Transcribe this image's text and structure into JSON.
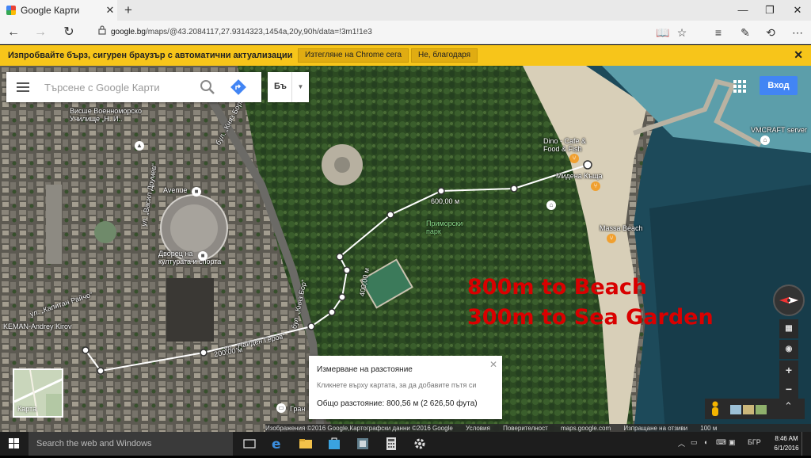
{
  "browser": {
    "tab_title": "Google Карти",
    "url_host": "google.bg",
    "url_path": "/maps/@43.2084117,27.9314323,1454a,20y,90h/data=!3m1!1e3"
  },
  "infobar": {
    "message": "Изпробвайте бърз, сигурен браузър с автоматични актуализации",
    "download_label": "Изтегляне на Chrome сега",
    "decline_label": "Не, благодаря"
  },
  "maps": {
    "search_placeholder": "Търсене с Google Карти",
    "language": "Бъ",
    "signin_label": "Вход",
    "minimap_label": "Карта",
    "labels": {
      "school": "Висше Военноморско\nУчилище „Н. И..",
      "avenue": "Avenue",
      "palace": "Дворец на\nкултурата и спорта",
      "keman": "KEMAN-Andrey Kirov",
      "dino": "Dino - Cafe &\nFood & Fish",
      "midena": "Мидена Къща",
      "massa": "Massa Beach",
      "vmcraft": "VMCRAFT server",
      "park": "Приморски\nпарк",
      "street_boris": "бул. „Княз Борис I“",
      "street_drumev": "ул. „Васил Друмев“",
      "street_capitan": "ул. „Капитан Райчо“",
      "street_naiden": "ул. „Найден Геров“",
      "street_boris2": "бул. „Княз Бор“",
      "gran": "Гран"
    },
    "distance_labels": [
      "600,00 м",
      "400,00 м",
      "200,00 м"
    ],
    "overlay_line1": "800m to Beach",
    "overlay_line2": "300m to Sea Garden",
    "measure": {
      "title": "Измерване на разстояние",
      "hint": "Кликнете върху картата, за да добавите пътя си",
      "total": "Общо разстояние: 800,56 м (2 626,50 фута)"
    },
    "attribution": {
      "imagery": "Изображения ©2016 Google,Картографски данни ©2016 Google",
      "terms": "Условия",
      "privacy": "Поверителност",
      "site": "maps.google.com",
      "feedback": "Изпращане на отзиви",
      "scale": "100 м"
    }
  },
  "taskbar": {
    "search_placeholder": "Search the web and Windows",
    "lang": "БГР",
    "time": "8:46 AM",
    "date": "6/1/2016"
  },
  "colors": {
    "overlay_text": "#d90000",
    "signin": "#4285f4",
    "infobar": "#f7c51a"
  }
}
